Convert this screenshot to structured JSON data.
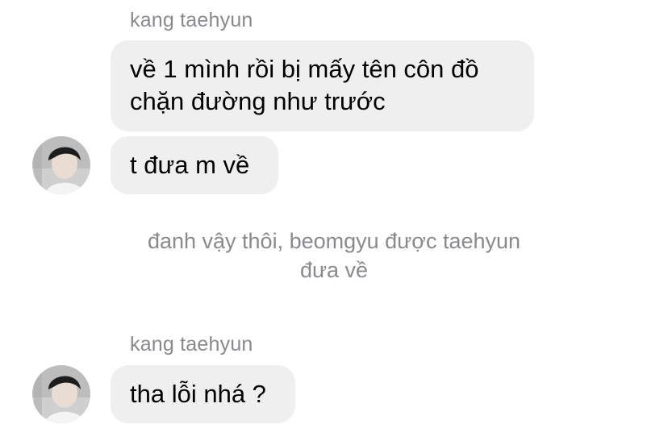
{
  "thread": {
    "group1": {
      "sender": "kang taehyun",
      "message1": {
        "lines": [
          "về 1 mình rồi bị mấy tên côn đồ",
          "chặn đường như trước"
        ]
      },
      "message2": {
        "text": "t đưa m về"
      },
      "avatar_icon": "profile-photo"
    },
    "system_note": {
      "lines": [
        "đanh vậy thôi, beomgyu được taehyun",
        "đưa về"
      ]
    },
    "group2": {
      "sender": "kang taehyun",
      "message1": {
        "text": "tha lỗi nhá ?"
      },
      "avatar_icon": "profile-photo"
    }
  },
  "colors": {
    "bubble_bg": "#efeff0",
    "secondary_text": "#8a8a8e",
    "primary_text": "#000000"
  }
}
